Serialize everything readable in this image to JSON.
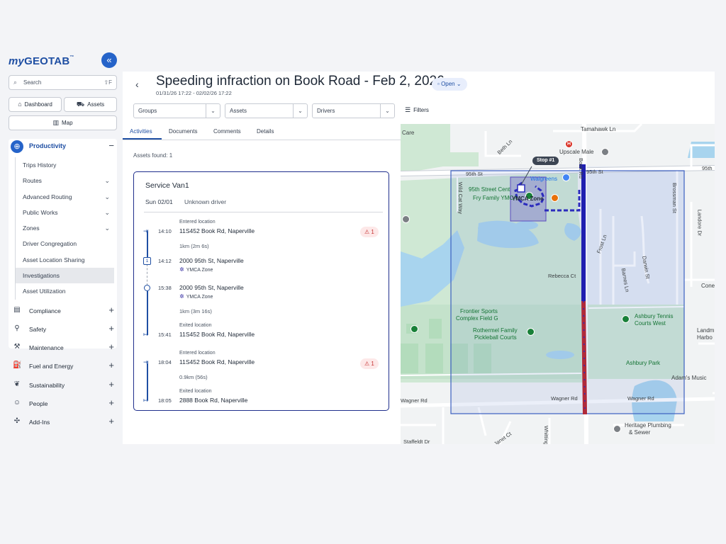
{
  "app": {
    "logo_my": "my",
    "logo_geotab": "GEOTAB",
    "logo_tm": "™",
    "collapse_label": "«"
  },
  "sidebar": {
    "search_placeholder": "Search",
    "search_shortcut": "⇧F",
    "dashboard_label": "Dashboard",
    "assets_label": "Assets",
    "map_label": "Map",
    "productivity": {
      "label": "Productivity",
      "items": [
        {
          "label": "Trips History",
          "chevron": ""
        },
        {
          "label": "Routes",
          "chevron": "⌄"
        },
        {
          "label": "Advanced Routing",
          "chevron": "⌄"
        },
        {
          "label": "Public Works",
          "chevron": "⌄"
        },
        {
          "label": "Zones",
          "chevron": "⌄"
        },
        {
          "label": "Driver Congregation",
          "chevron": ""
        },
        {
          "label": "Asset Location Sharing",
          "chevron": ""
        },
        {
          "label": "Investigations",
          "chevron": ""
        },
        {
          "label": "Asset Utilization",
          "chevron": ""
        }
      ]
    },
    "menu": [
      {
        "label": "Compliance",
        "icon": "compliance-icon"
      },
      {
        "label": "Safety",
        "icon": "safety-icon"
      },
      {
        "label": "Maintenance",
        "icon": "wrench-icon"
      },
      {
        "label": "Fuel and Energy",
        "icon": "fuel-icon"
      },
      {
        "label": "Sustainability",
        "icon": "leaf-icon"
      },
      {
        "label": "People",
        "icon": "people-icon"
      },
      {
        "label": "Add-Ins",
        "icon": "puzzle-icon"
      }
    ]
  },
  "header": {
    "title": "Speeding infraction on Book Road - Feb 2, 2026",
    "subtitle": "01/31/26 17:22 - 02/02/26 17:22",
    "status": "Open",
    "filters": {
      "groups": "Groups",
      "assets": "Assets",
      "drivers": "Drivers",
      "filters_label": "Filters"
    }
  },
  "tabs": [
    "Activities",
    "Documents",
    "Comments",
    "Details"
  ],
  "panel": {
    "assets_found": "Assets found: 1",
    "card": {
      "title": "Service Van1",
      "date": "Sun 02/01",
      "driver": "Unknown driver",
      "events": [
        {
          "label": "Entered location",
          "time": "14:10",
          "address": "11S452 Book Rd, Naperville",
          "badge": "1"
        },
        {
          "dist": "1km (2m 6s)"
        },
        {
          "stop": "1",
          "time": "14:12",
          "address": "2000 95th St, Naperville",
          "zone": "YMCA Zone"
        },
        {
          "time": "15:38",
          "address": "2000 95th St, Naperville",
          "zone": "YMCA Zone"
        },
        {
          "dist": "1km (3m 16s)"
        },
        {
          "label": "Exited location",
          "time": "15:41",
          "address": "11S452 Book Rd, Naperville"
        },
        {
          "label": "Entered location",
          "time": "18:04",
          "address": "11S452 Book Rd, Naperville",
          "badge": "1"
        },
        {
          "dist": "0.9km (56s)"
        },
        {
          "label": "Exited location",
          "time": "18:05",
          "address": "2888 Book Rd, Naperville"
        }
      ]
    }
  },
  "map": {
    "stop_tag": "Stop #1",
    "labels": {
      "care": "Care",
      "tamahawk": "Tamahawk Ln",
      "beth": "Beth Ln",
      "upscale": "Upscale Male",
      "st95_a": "95th St",
      "st95_b": "95th St",
      "st95_c": "95th",
      "book_rd": "Book Rd",
      "walgreens": "Walgreens",
      "center": "95th Street Cent",
      "fry": "Fry Family YMCA",
      "ymca_zone": "YMCA Zone",
      "wildcat": "Wild Cat Way",
      "brossman": "Brossman St",
      "landore": "Landore Dr",
      "frost": "Frost Ln",
      "darwin": "Darwin St",
      "barnes": "Barnes Ln",
      "rebecca": "Rebecca Ct",
      "cone": "Cone",
      "frontier": "Frontier Sports",
      "frontier2": "Complex Field G",
      "rothermel": "Rothermel Family",
      "pickleball": "Pickleball Courts",
      "ashbury_tennis": "Ashbury Tennis",
      "courts_west": "Courts West",
      "landm": "Landm",
      "harbo": "Harbo",
      "ashbury_park": "Ashbury Park",
      "adams": "Adam's Music",
      "wagner_a": "Wagner Rd",
      "wagner_b": "Wagner Rd",
      "wagner_c": "Wagner Rd",
      "heritage": "Heritage Plumbing",
      "heritage2": "& Sewer",
      "staffeldt": "Staffeldt Dr",
      "janet": "Janet Ct",
      "whittington": "Whitting"
    }
  }
}
